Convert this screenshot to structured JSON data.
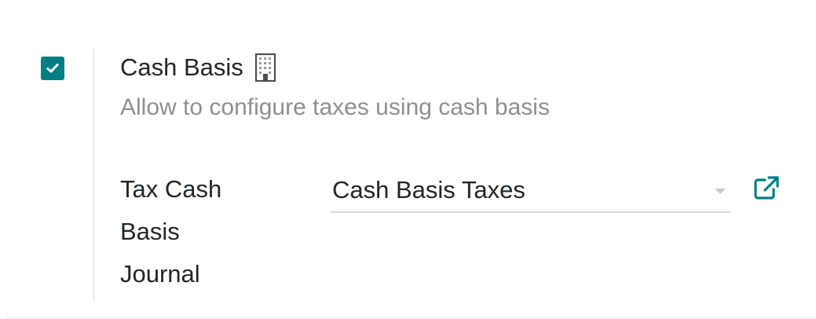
{
  "setting": {
    "checked": true,
    "title": "Cash Basis",
    "description": "Allow to configure taxes using cash basis",
    "company_icon": "building-icon",
    "checkbox_color": "#017e84"
  },
  "field": {
    "label_lines": [
      "Tax Cash",
      "Basis",
      "Journal"
    ],
    "value": "Cash Basis Taxes",
    "dropdown_icon": "caret-down-icon",
    "external_icon": "external-link-icon",
    "external_color": "#017e84"
  }
}
